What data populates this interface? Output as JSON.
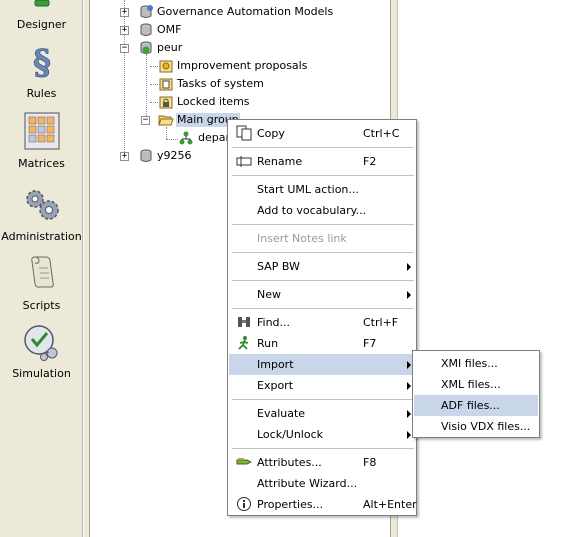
{
  "nav": {
    "items": [
      {
        "label": "Designer",
        "icon": "designer-icon"
      },
      {
        "label": "Rules",
        "icon": "rules-icon"
      },
      {
        "label": "Matrices",
        "icon": "matrices-icon"
      },
      {
        "label": "Administration",
        "icon": "administration-icon"
      },
      {
        "label": "Scripts",
        "icon": "scripts-icon"
      },
      {
        "label": "Simulation",
        "icon": "simulation-icon"
      }
    ]
  },
  "tree": {
    "governance": "Governance Automation Models",
    "omf": "OMF",
    "peur": "peur",
    "improvement": "Improvement proposals",
    "tasks": "Tasks of system",
    "locked": "Locked items",
    "main_group": "Main group",
    "department": "depar",
    "y9256": "y9256"
  },
  "menu": {
    "copy": {
      "label": "Copy",
      "shortcut": "Ctrl+C"
    },
    "rename": {
      "label": "Rename",
      "shortcut": "F2"
    },
    "start_uml": {
      "label": "Start UML action..."
    },
    "add_vocab": {
      "label": "Add to vocabulary..."
    },
    "insert_notes": {
      "label": "Insert Notes link"
    },
    "sap_bw": {
      "label": "SAP BW"
    },
    "new": {
      "label": "New"
    },
    "find": {
      "label": "Find...",
      "shortcut": "Ctrl+F"
    },
    "run": {
      "label": "Run",
      "shortcut": "F7"
    },
    "import": {
      "label": "Import"
    },
    "export": {
      "label": "Export"
    },
    "evaluate": {
      "label": "Evaluate"
    },
    "lock_unlock": {
      "label": "Lock/Unlock"
    },
    "attributes": {
      "label": "Attributes...",
      "shortcut": "F8"
    },
    "attr_wizard": {
      "label": "Attribute Wizard..."
    },
    "properties": {
      "label": "Properties...",
      "shortcut": "Alt+Enter"
    }
  },
  "submenu": {
    "xmi": "XMI files...",
    "xml": "XML files...",
    "adf": "ADF files...",
    "visio": "Visio VDX files..."
  },
  "colors": {
    "highlight": "#c9d5e9",
    "panel": "#ece9d8",
    "disabled_text": "#9a9a9a"
  }
}
